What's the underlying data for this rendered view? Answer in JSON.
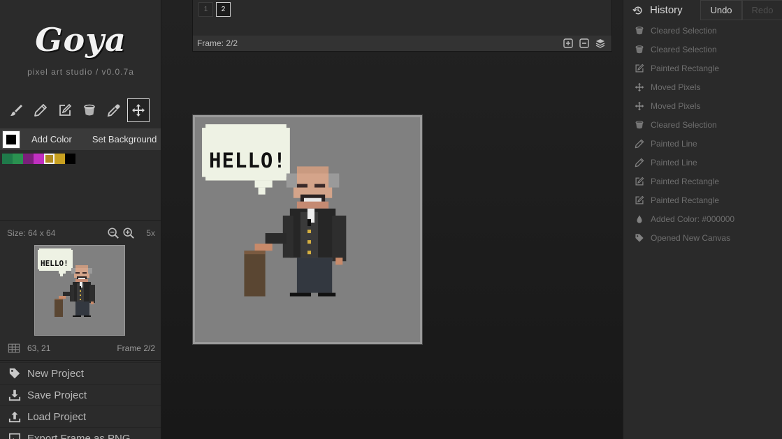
{
  "app": {
    "name": "Goya",
    "subtitle": "pixel art studio / v0.0.7a"
  },
  "tools": [
    {
      "name": "brush-tool",
      "icon": "brush-icon",
      "active": false
    },
    {
      "name": "pencil-tool",
      "icon": "pencil-icon",
      "active": false
    },
    {
      "name": "rectangle-tool",
      "icon": "edit-square-icon",
      "active": false
    },
    {
      "name": "bucket-tool",
      "icon": "bucket-icon",
      "active": false
    },
    {
      "name": "eyedropper-tool",
      "icon": "eyedropper-icon",
      "active": false
    },
    {
      "name": "move-tool",
      "icon": "move-icon",
      "active": true
    }
  ],
  "colors": {
    "current": "#000000",
    "add_label": "Add Color",
    "background_label": "Set Background",
    "palette": [
      "#1f7a4a",
      "#2a9150",
      "#7a1f7a",
      "#c030c0",
      "#b08a20",
      "#c8a020",
      "#000000"
    ],
    "selected_index": 4
  },
  "canvas_info": {
    "size": "Size: 64 x 64",
    "zoom": "5x",
    "coords": "63, 21",
    "frame": "Frame 2/2"
  },
  "menu": [
    {
      "label": "New Project",
      "icon": "tag-icon"
    },
    {
      "label": "Save Project",
      "icon": "download-icon"
    },
    {
      "label": "Load Project",
      "icon": "upload-icon"
    },
    {
      "label": "Export Frame as PNG",
      "icon": "image-icon"
    }
  ],
  "frames": {
    "thumbs": [
      "1",
      "2"
    ],
    "active": 1,
    "bar_label": "Frame: 2/2"
  },
  "artwork": {
    "speech_text": "HELLO!"
  },
  "history": {
    "title": "History",
    "undo": "Undo",
    "redo": "Redo",
    "items": [
      {
        "label": "Cleared Selection",
        "icon": "bucket-icon"
      },
      {
        "label": "Cleared Selection",
        "icon": "bucket-icon"
      },
      {
        "label": "Painted Rectangle",
        "icon": "edit-square-icon"
      },
      {
        "label": "Moved Pixels",
        "icon": "move-icon"
      },
      {
        "label": "Moved Pixels",
        "icon": "move-icon"
      },
      {
        "label": "Cleared Selection",
        "icon": "bucket-icon"
      },
      {
        "label": "Painted Line",
        "icon": "pencil-icon"
      },
      {
        "label": "Painted Line",
        "icon": "pencil-icon"
      },
      {
        "label": "Painted Rectangle",
        "icon": "edit-square-icon"
      },
      {
        "label": "Painted Rectangle",
        "icon": "edit-square-icon"
      },
      {
        "label": "Added Color: #000000",
        "icon": "droplet-icon"
      },
      {
        "label": "Opened New Canvas",
        "icon": "tag-icon"
      }
    ]
  }
}
